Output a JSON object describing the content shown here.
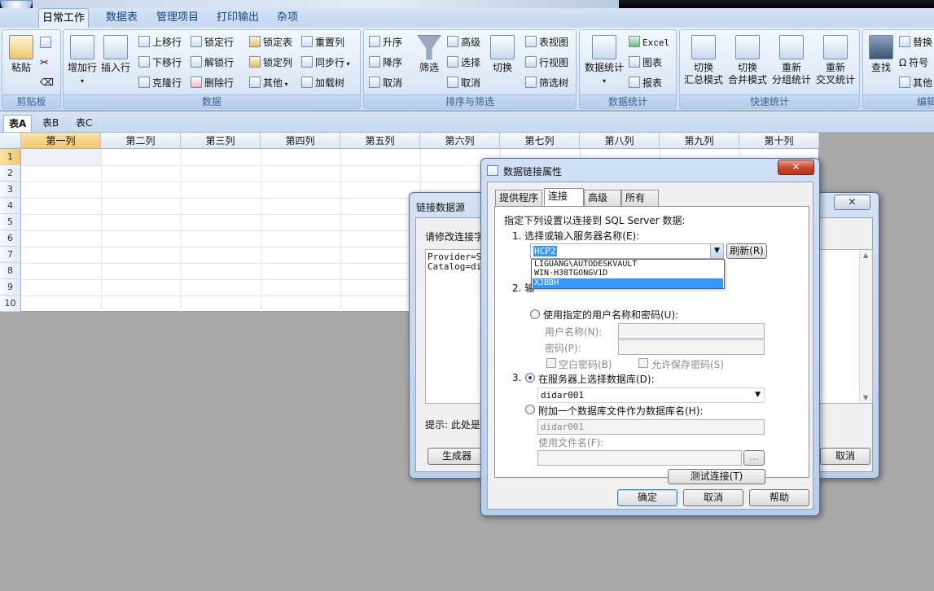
{
  "ribbon": {
    "tabs": [
      "日常工作",
      "数据表",
      "管理项目",
      "打印输出",
      "杂项"
    ],
    "groups": {
      "clipboard": {
        "label": "剪贴板",
        "paste": "粘贴"
      },
      "data": {
        "label": "数据",
        "add_row": "增加行",
        "insert_row": "插入行",
        "move_up": "上移行",
        "move_down": "下移行",
        "clone_row": "克隆行",
        "lock_row": "锁定行",
        "unlock_row": "解锁行",
        "delete_row": "删除行",
        "lock_table": "锁定表",
        "lock_col": "锁定列",
        "other": "其他",
        "reset_col": "重置列",
        "sync_row": "同步行",
        "load_tree": "加载树"
      },
      "sort": {
        "label": "排序与筛选",
        "asc": "升序",
        "desc": "降序",
        "cancel": "取消",
        "filter": "筛选",
        "advanced": "高级",
        "select": "选择",
        "cancel2": "取消",
        "toggle": "切换",
        "table_view": "表视图",
        "row_view": "行视图",
        "filter_tree": "筛选树"
      },
      "stats": {
        "label": "数据统计",
        "data_stats": "数据统计",
        "excel": "Excel",
        "chart": "图表",
        "report": "报表"
      },
      "quick": {
        "label": "快速统计",
        "mode1": "切换",
        "mode1b": "汇总模式",
        "mode2": "切换",
        "mode2b": "合并模式",
        "mode3": "重新",
        "mode3b": "分组统计",
        "mode4": "重新",
        "mode4b": "交叉统计"
      },
      "edit": {
        "label": "编辑",
        "find": "查找",
        "replace": "替换",
        "symbol": "符号",
        "other": "其他"
      }
    }
  },
  "sheet_tabs": [
    "表A",
    "表B",
    "表C"
  ],
  "grid": {
    "columns": [
      "第一列",
      "第二列",
      "第三列",
      "第四列",
      "第五列",
      "第六列",
      "第七列",
      "第八列",
      "第九列",
      "第十列"
    ],
    "rows": [
      "1",
      "2",
      "3",
      "4",
      "5",
      "6",
      "7",
      "8",
      "9",
      "10"
    ]
  },
  "back_dialog": {
    "title": "链接数据源",
    "prompt": "请修改连接字",
    "conn_line1": "Provider=SQ",
    "conn_line2": "Catalog=did",
    "hint": "提示: 此处是",
    "generator": "生成器",
    "cancel": "取消",
    "close": "✕"
  },
  "front_dialog": {
    "title": "数据链接属性",
    "close": "✕",
    "tabs": [
      "提供程序",
      "连接",
      "高级",
      "所有"
    ],
    "intro": "指定下列设置以连接到 SQL Server 数据:",
    "step1": "1. 选择或输入服务器名称(E):",
    "server_value": "HCP2",
    "refresh": "刷新(R)",
    "server_options": [
      "LIGUANG\\AUTODESKVAULT",
      "WIN-H38TGONGV1D",
      "XJBBH"
    ],
    "step2_prefix": "2. 输",
    "use_specific": "使用指定的用户名称和密码(U):",
    "username_label": "用户名称(N):",
    "password_label": "密码(P):",
    "blank_password": "空白密码(B)",
    "allow_save": "允许保存密码(S)",
    "step3": "3.",
    "select_db": "在服务器上选择数据库(D):",
    "db_value": "didar001",
    "attach_db": "附加一个数据库文件作为数据库名(H):",
    "attach_value": "didar001",
    "use_filename": "使用文件名(F):",
    "browse": "...",
    "test_conn": "测试连接(T)",
    "ok": "确定",
    "cancel": "取消",
    "help": "帮助"
  }
}
